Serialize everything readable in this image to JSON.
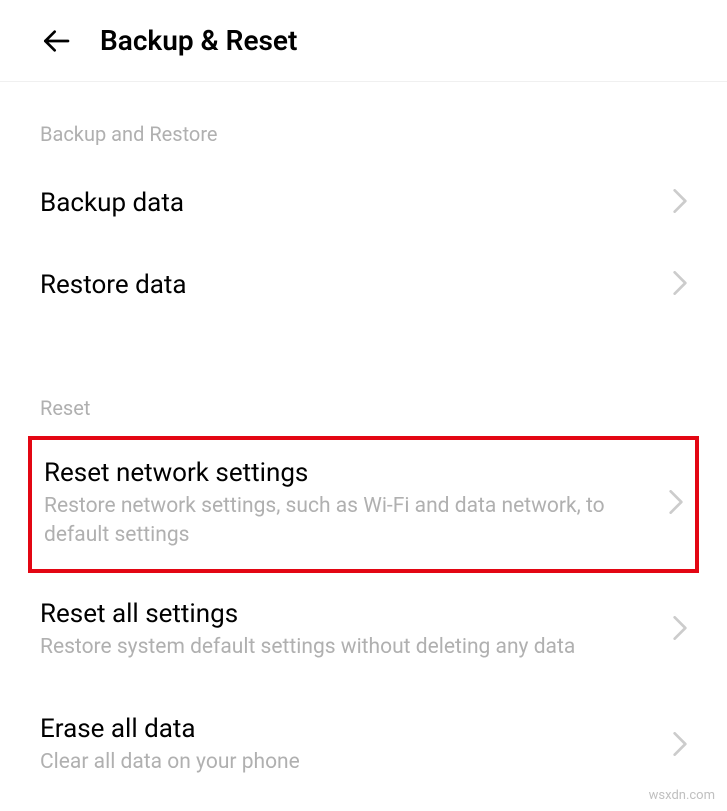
{
  "header": {
    "title": "Backup & Reset"
  },
  "sections": {
    "backup": {
      "header": "Backup and Restore",
      "items": [
        {
          "title": "Backup data"
        },
        {
          "title": "Restore data"
        }
      ]
    },
    "reset": {
      "header": "Reset",
      "items": [
        {
          "title": "Reset network settings",
          "subtitle": "Restore network settings, such as Wi-Fi and data network, to default settings"
        },
        {
          "title": "Reset all settings",
          "subtitle": "Restore system default settings without deleting any data"
        },
        {
          "title": "Erase all data",
          "subtitle": "Clear all data on your phone"
        }
      ]
    }
  },
  "watermark": "wsxdn.com"
}
